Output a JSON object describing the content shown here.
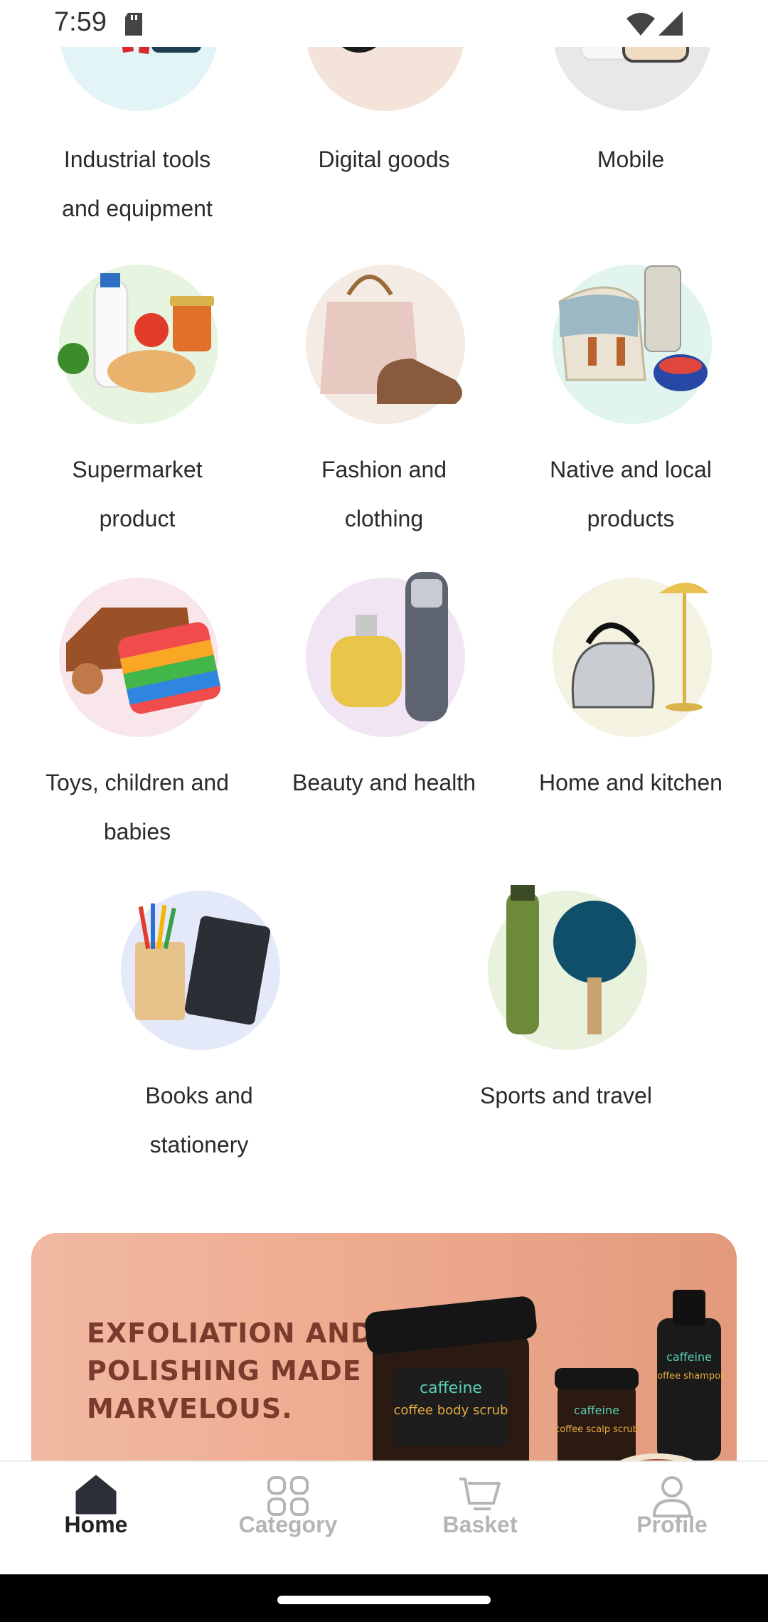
{
  "status_bar": {
    "time": "7:59"
  },
  "categories": [
    {
      "id": "industrial",
      "label_lines": [
        "Industrial tools",
        "and equipment"
      ],
      "bg": "#e3f4f6"
    },
    {
      "id": "digital",
      "label_lines": [
        "Digital goods"
      ],
      "bg": "#f3e3d8"
    },
    {
      "id": "mobile",
      "label_lines": [
        "Mobile"
      ],
      "bg": "#e8e8e8"
    },
    {
      "id": "supermarket",
      "label_lines": [
        "Supermarket",
        "product"
      ],
      "bg": "#e7f4e0"
    },
    {
      "id": "fashion",
      "label_lines": [
        "Fashion and",
        "clothing"
      ],
      "bg": "#f4ece4"
    },
    {
      "id": "native",
      "label_lines": [
        "Native and local",
        "products"
      ],
      "bg": "#e2f4ef"
    },
    {
      "id": "toys",
      "label_lines": [
        "Toys, children and",
        "babies"
      ],
      "bg": "#f8e6ea"
    },
    {
      "id": "beauty",
      "label_lines": [
        "Beauty and health"
      ],
      "bg": "#f1e5f4"
    },
    {
      "id": "home",
      "label_lines": [
        "Home and kitchen"
      ],
      "bg": "#f4f2e0"
    },
    {
      "id": "books",
      "label_lines": [
        "Books and",
        "stationery"
      ],
      "bg": "#e3e9f8"
    },
    {
      "id": "sports",
      "label_lines": [
        "Sports and travel"
      ],
      "bg": "#e8f2dc"
    }
  ],
  "banner": {
    "headline": "EXFOLIATION AND POLISHING MADE MARVELOUS.",
    "brand": "caffeine",
    "products": [
      "coffee body scrub",
      "coffee scalp scrub",
      "coffee shampoo"
    ]
  },
  "bottom_nav": [
    {
      "id": "home",
      "label": "Home",
      "active": true,
      "icon": "home-icon"
    },
    {
      "id": "category",
      "label": "Category",
      "active": false,
      "icon": "grid-icon"
    },
    {
      "id": "basket",
      "label": "Basket",
      "active": false,
      "icon": "cart-icon"
    },
    {
      "id": "profile",
      "label": "Profile",
      "active": false,
      "icon": "person-icon"
    }
  ],
  "colors": {
    "active_nav": "#222222",
    "inactive_nav": "#b5b5b5",
    "banner_text": "#7a3b2c",
    "banner_bg": "#eeab90"
  }
}
